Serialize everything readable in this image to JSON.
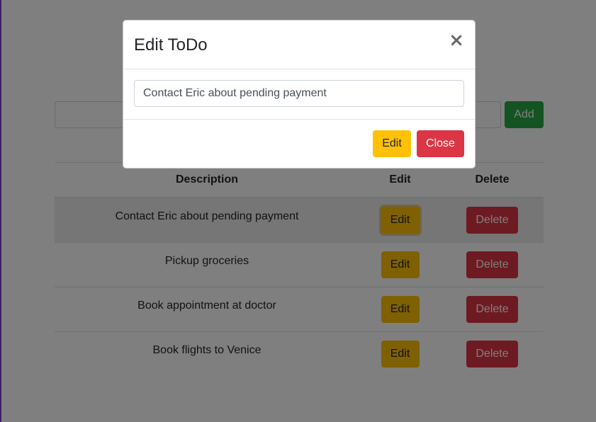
{
  "add_form": {
    "input_value": "",
    "add_label": "Add"
  },
  "table": {
    "headers": {
      "description": "Description",
      "edit": "Edit",
      "delete": "Delete"
    },
    "rows": [
      {
        "description": "Contact Eric about pending payment",
        "edit_label": "Edit",
        "delete_label": "Delete"
      },
      {
        "description": "Pickup groceries",
        "edit_label": "Edit",
        "delete_label": "Delete"
      },
      {
        "description": "Book appointment at doctor",
        "edit_label": "Edit",
        "delete_label": "Delete"
      },
      {
        "description": "Book flights to Venice",
        "edit_label": "Edit",
        "delete_label": "Delete"
      }
    ]
  },
  "modal": {
    "title": "Edit ToDo",
    "close_icon": "×",
    "input_value": "Contact Eric about pending payment",
    "edit_label": "Edit",
    "close_label": "Close"
  },
  "colors": {
    "success": "#28a745",
    "warning": "#ffc107",
    "danger": "#dc3545",
    "accent_edge": "#7b3fbf"
  }
}
